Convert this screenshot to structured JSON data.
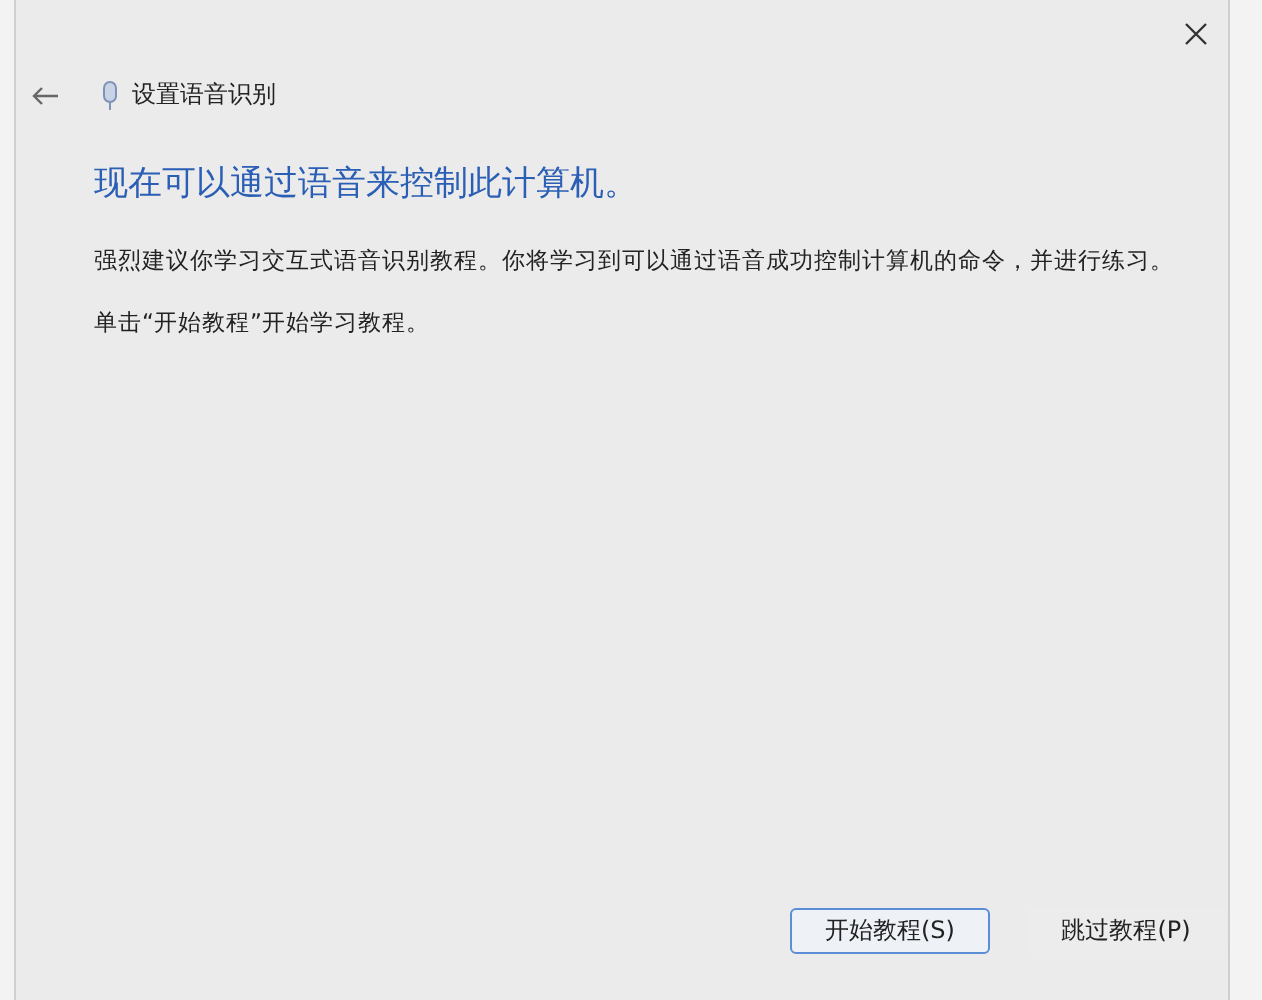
{
  "window": {
    "title": "设置语音识别"
  },
  "heading": "现在可以通过语音来控制此计算机。",
  "paragraphs": [
    "强烈建议你学习交互式语音识别教程。你将学习到可以通过语音成功控制计算机的命令，并进行练习。",
    "单击“开始教程”开始学习教程。"
  ],
  "buttons": [
    {
      "label": "开始教程(S)",
      "default": true
    },
    {
      "label": "跳过教程(P)",
      "default": false
    }
  ]
}
